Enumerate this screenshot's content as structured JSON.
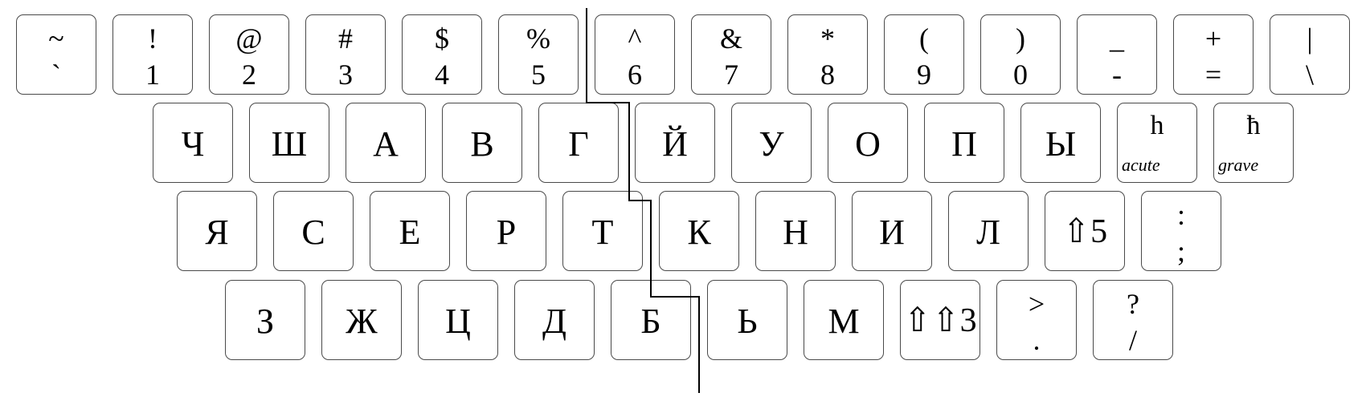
{
  "rows": [
    [
      {
        "top": "~",
        "bottom": "`"
      },
      {
        "top": "!",
        "bottom": "1"
      },
      {
        "top": "@",
        "bottom": "2"
      },
      {
        "top": "#",
        "bottom": "3"
      },
      {
        "top": "$",
        "bottom": "4"
      },
      {
        "top": "%",
        "bottom": "5"
      },
      {
        "top": "^",
        "bottom": "6"
      },
      {
        "top": "&",
        "bottom": "7"
      },
      {
        "top": "*",
        "bottom": "8"
      },
      {
        "top": "(",
        "bottom": "9"
      },
      {
        "top": ")",
        "bottom": "0"
      },
      {
        "top": "_",
        "bottom": "-"
      },
      {
        "top": "+",
        "bottom": "="
      },
      {
        "top": "|",
        "bottom": "\\"
      }
    ],
    [
      {
        "main": "Ч"
      },
      {
        "main": "Ш"
      },
      {
        "main": "А"
      },
      {
        "main": "В"
      },
      {
        "main": "Г"
      },
      {
        "main": "Й"
      },
      {
        "main": "У"
      },
      {
        "main": "О"
      },
      {
        "main": "П"
      },
      {
        "main": "Ы"
      },
      {
        "top": "h",
        "bottom": "acute",
        "kind": "modifier"
      },
      {
        "top": "ħ",
        "bottom": "grave",
        "kind": "modifier"
      }
    ],
    [
      {
        "main": "Я"
      },
      {
        "main": "С"
      },
      {
        "main": "Е"
      },
      {
        "main": "Р"
      },
      {
        "main": "Т"
      },
      {
        "main": "К"
      },
      {
        "main": "Н"
      },
      {
        "main": "И"
      },
      {
        "main": "Л"
      },
      {
        "main": "⇧5"
      },
      {
        "top": ":",
        "bottom": ";"
      }
    ],
    [
      {
        "main": "З"
      },
      {
        "main": "Ж"
      },
      {
        "main": "Ц"
      },
      {
        "main": "Д"
      },
      {
        "main": "Б"
      },
      {
        "main": "Ь"
      },
      {
        "main": "М"
      },
      {
        "main": "⇧⇧3"
      },
      {
        "top": ">",
        "bottom": "."
      },
      {
        "top": "?",
        "bottom": "/"
      }
    ]
  ],
  "colors": {
    "border": "#4a4a4a",
    "divider": "#000000",
    "text": "#000000",
    "background": "#ffffff"
  }
}
